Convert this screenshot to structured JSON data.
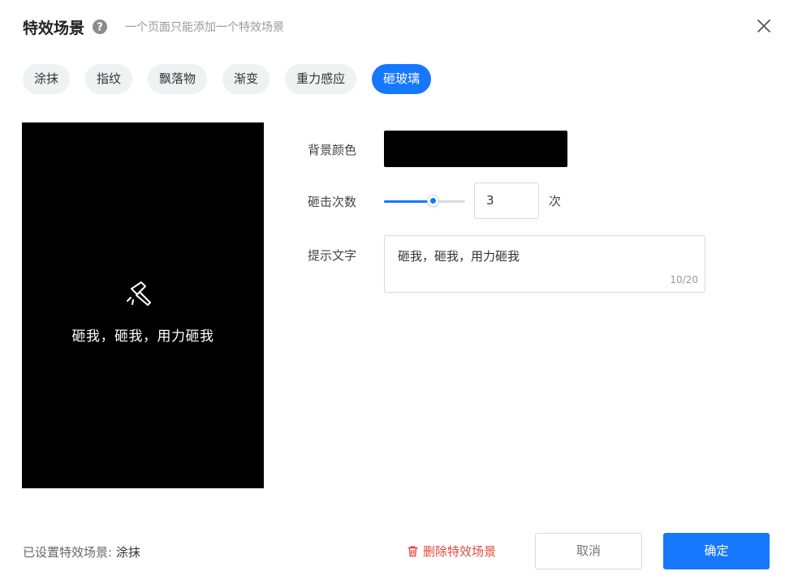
{
  "header": {
    "title": "特效场景",
    "subtitle": "一个页面只能添加一个特效场景",
    "help_icon": "question-circle-icon",
    "close_icon": "close-icon"
  },
  "tabs": [
    {
      "label": "涂抹",
      "active": false
    },
    {
      "label": "指纹",
      "active": false
    },
    {
      "label": "飘落物",
      "active": false
    },
    {
      "label": "渐变",
      "active": false
    },
    {
      "label": "重力感应",
      "active": false
    },
    {
      "label": "砸玻璃",
      "active": true
    }
  ],
  "preview": {
    "background": "#000000",
    "icon": "hammer-icon",
    "text": "砸我，砸我，用力砸我"
  },
  "form": {
    "bg_color_label": "背景颜色",
    "bg_color_value": "#000000",
    "hits_label": "砸击次数",
    "hits_value": "3",
    "hits_unit": "次",
    "hits_slider_fraction": 0.6,
    "hint_label": "提示文字",
    "hint_value": "砸我，砸我，用力砸我",
    "hint_count": "10/20"
  },
  "footer": {
    "status_label": "已设置特效场景:",
    "status_value": "涂抹",
    "delete_label": "删除特效场景",
    "cancel_label": "取消",
    "ok_label": "确定"
  },
  "colors": {
    "accent": "#1677ff",
    "danger": "#e8463c"
  }
}
